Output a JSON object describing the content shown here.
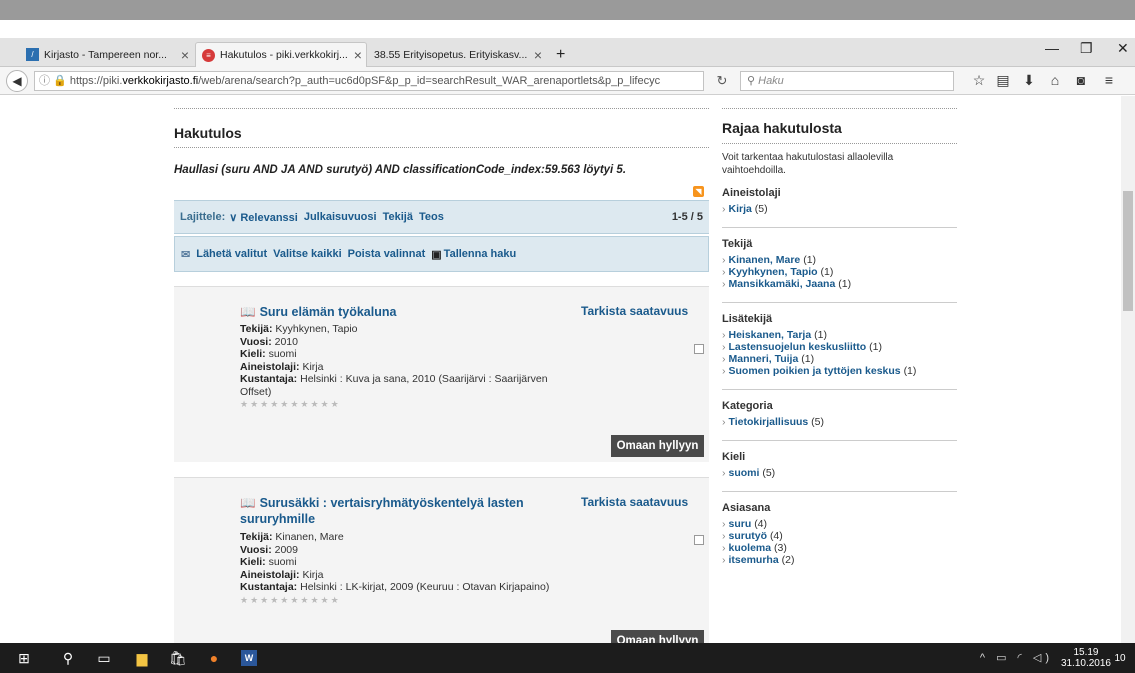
{
  "browser": {
    "tabs": [
      {
        "label": "Kirjasto - Tampereen nor...",
        "active": false,
        "icon": "library-favicon"
      },
      {
        "label": "Hakutulos - piki.verkkokirj...",
        "active": true,
        "icon": "piki-favicon"
      },
      {
        "label": "38.55 Erityisopetus. Erityiskasv...",
        "active": false,
        "icon": "blank-favicon"
      }
    ],
    "new_tab": "+",
    "url_prefix": "https://piki.",
    "url_domain": "verkkokirjasto.fi",
    "url_rest": "/web/arena/search?p_auth=uc6d0pSF&p_p_id=searchResult_WAR_arenaportlets&p_p_lifecyc",
    "search_placeholder": "Haku"
  },
  "main": {
    "title": "Hakutulos",
    "query": "Haullasi (suru AND JA AND surutyö) AND classificationCode_index:59.563 löytyi 5.",
    "sort": {
      "label": "Lajittele:",
      "options": [
        "∨ Relevanssi",
        "Julkaisuvuosi",
        "Tekijä",
        "Teos"
      ],
      "count": "1-5 / 5"
    },
    "actions": {
      "send": "Lähetä valitut",
      "select_all": "Valitse kaikki",
      "remove": "Poista valinnat",
      "save": "Tallenna haku"
    },
    "results": [
      {
        "title": "Suru elämän työkaluna",
        "availability": "Tarkista saatavuus",
        "author_label": "Tekijä:",
        "author": "Kyyhkynen, Tapio",
        "year_label": "Vuosi:",
        "year": "2010",
        "lang_label": "Kieli:",
        "lang": "suomi",
        "type_label": "Aineistolaji:",
        "type": "Kirja",
        "publisher_label": "Kustantaja:",
        "publisher": "Helsinki : Kuva ja sana, 2010 (Saarijärvi : Saarijärven Offset)",
        "stars": "★★★★★★★★★★",
        "shelf_button": "Omaan hyllyyn"
      },
      {
        "title": "Surusäkki : vertaisryhmätyöskentelyä lasten sururyhmille",
        "availability": "Tarkista saatavuus",
        "author_label": "Tekijä:",
        "author": "Kinanen, Mare",
        "year_label": "Vuosi:",
        "year": "2009",
        "lang_label": "Kieli:",
        "lang": "suomi",
        "type_label": "Aineistolaji:",
        "type": "Kirja",
        "publisher_label": "Kustantaja:",
        "publisher": "Helsinki : LK-kirjat, 2009 (Keuruu : Otavan Kirjapaino)",
        "stars": "★★★★★★★★★★",
        "shelf_button": "Omaan hyllyyn"
      }
    ]
  },
  "sidebar": {
    "title": "Rajaa hakutulosta",
    "intro": "Voit tarkentaa hakutulostasi allaolevilla vaihtoehdoilla.",
    "groups": [
      {
        "title": "Aineistolaji",
        "items": [
          {
            "label": "Kirja",
            "count": "(5)"
          }
        ]
      },
      {
        "title": "Tekijä",
        "items": [
          {
            "label": "Kinanen, Mare",
            "count": "(1)"
          },
          {
            "label": "Kyyhkynen, Tapio",
            "count": "(1)"
          },
          {
            "label": "Mansikkamäki, Jaana",
            "count": "(1)"
          }
        ]
      },
      {
        "title": "Lisätekijä",
        "items": [
          {
            "label": "Heiskanen, Tarja",
            "count": "(1)"
          },
          {
            "label": "Lastensuojelun keskusliitto",
            "count": "(1)"
          },
          {
            "label": "Manneri, Tuija",
            "count": "(1)"
          },
          {
            "label": "Suomen poikien ja tyttöjen keskus",
            "count": "(1)"
          }
        ]
      },
      {
        "title": "Kategoria",
        "items": [
          {
            "label": "Tietokirjallisuus",
            "count": "(5)"
          }
        ]
      },
      {
        "title": "Kieli",
        "items": [
          {
            "label": "suomi",
            "count": "(5)"
          }
        ]
      },
      {
        "title": "Asiasana",
        "items": [
          {
            "label": "suru",
            "count": "(4)"
          },
          {
            "label": "surutyö",
            "count": "(4)"
          },
          {
            "label": "kuolema",
            "count": "(3)"
          },
          {
            "label": "itsemurha",
            "count": "(2)"
          }
        ]
      }
    ]
  },
  "taskbar": {
    "time": "15.19",
    "date": "31.10.2016",
    "notifications": "10"
  }
}
